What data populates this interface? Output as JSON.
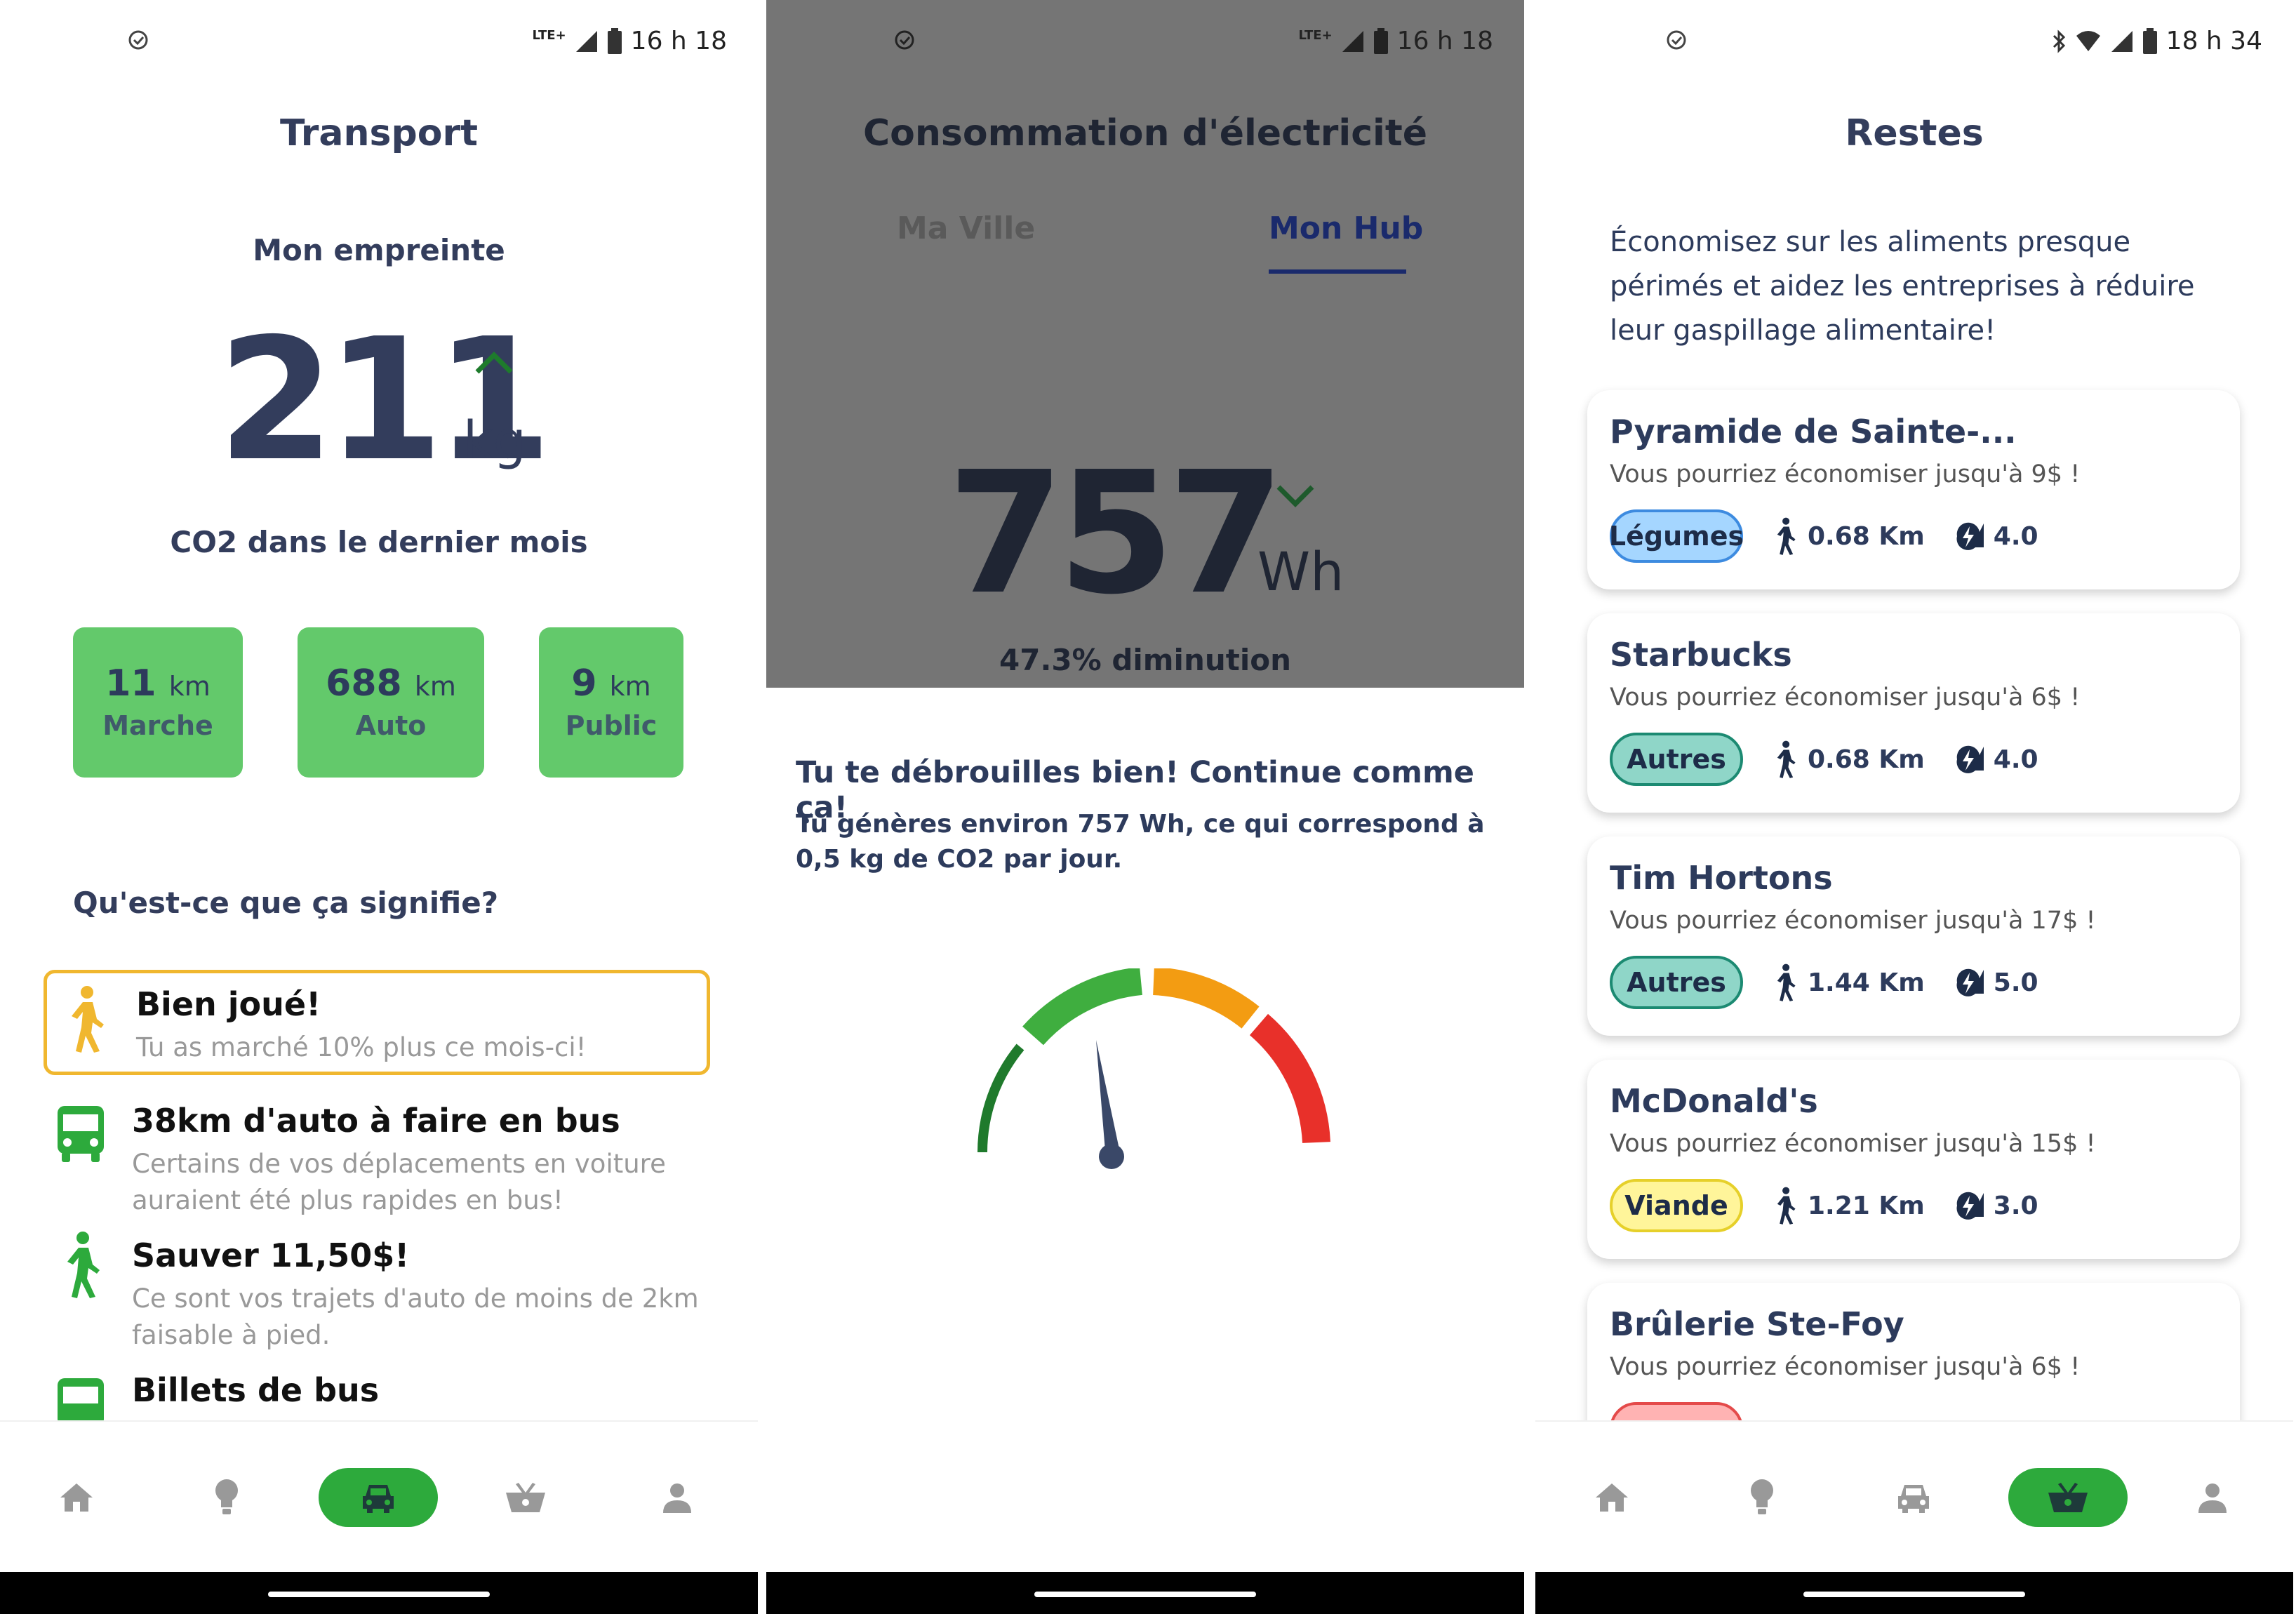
{
  "s1": {
    "status_time": "16 h 18",
    "status_net": "LTE+",
    "title": "Transport",
    "footprint_label": "Mon empreinte",
    "value": "211",
    "unit": "kg",
    "period_label": "CO2 dans le dernier mois",
    "stats": [
      {
        "value": "11",
        "unit": "km",
        "label": "Marche"
      },
      {
        "value": "688",
        "unit": "km",
        "label": "Auto"
      },
      {
        "value": "9",
        "unit": "km",
        "label": "Public"
      }
    ],
    "meaning_title": "Qu'est-ce que ça signifie?",
    "tips": [
      {
        "title": "Bien joué!",
        "sub": "Tu as marché 10% plus ce mois-ci!"
      },
      {
        "title": "38km d'auto à faire en bus",
        "sub1": "Certains de vos déplacements en voiture",
        "sub2": "auraient été plus rapides en bus!"
      },
      {
        "title": "Sauver 11,50$!",
        "sub1": "Ce sont vos trajets d'auto de moins de 2km",
        "sub2": "faisable à pied."
      },
      {
        "title": "Billets de bus"
      }
    ]
  },
  "s2": {
    "status_time": "16 h 18",
    "status_net": "LTE+",
    "title": "Consommation d'électricité",
    "tabs": [
      {
        "label": "Ma Ville"
      },
      {
        "label": "Mon Hub"
      }
    ],
    "value": "757",
    "unit": "Wh",
    "change": "47.3% diminution",
    "msg_title": "Tu te débrouilles bien! Continue comme ça!",
    "msg_line1": "Tu génères environ 757 Wh, ce qui correspond à",
    "msg_line2": "0,5 kg de CO2 par jour."
  },
  "s3": {
    "status_time": "18 h 34",
    "title": "Restes",
    "intro1": "Économisez sur les aliments presque",
    "intro2": "périmés et aidez les entreprises à réduire",
    "intro3": "leur gaspillage alimentaire!",
    "cards": [
      {
        "name": "Pyramide de Sainte-...",
        "sub": "Vous pourriez économiser jusqu'à 9$ !",
        "chip": "Légumes",
        "dist": "0.68 Km",
        "score": "4.0"
      },
      {
        "name": "Starbucks",
        "sub": "Vous pourriez économiser jusqu'à 6$ !",
        "chip": "Autres",
        "dist": "0.68 Km",
        "score": "4.0"
      },
      {
        "name": "Tim Hortons",
        "sub": "Vous pourriez économiser jusqu'à 17$ !",
        "chip": "Autres",
        "dist": "1.44 Km",
        "score": "5.0"
      },
      {
        "name": "McDonald's",
        "sub": "Vous pourriez économiser jusqu'à 15$ !",
        "chip": "Viande",
        "dist": "1.21 Km",
        "score": "3.0"
      },
      {
        "name": "Brûlerie Ste-Foy",
        "sub": "Vous pourriez économiser jusqu'à 6$ !"
      }
    ]
  },
  "colors": {
    "accent": "#2daa3c",
    "stat_card": "#63c96b",
    "text": "#333d5c",
    "gauge_dark": "#1f7a2c",
    "gauge_green": "#3fae3f",
    "gauge_orange": "#f39c12",
    "gauge_red": "#e8302a"
  }
}
